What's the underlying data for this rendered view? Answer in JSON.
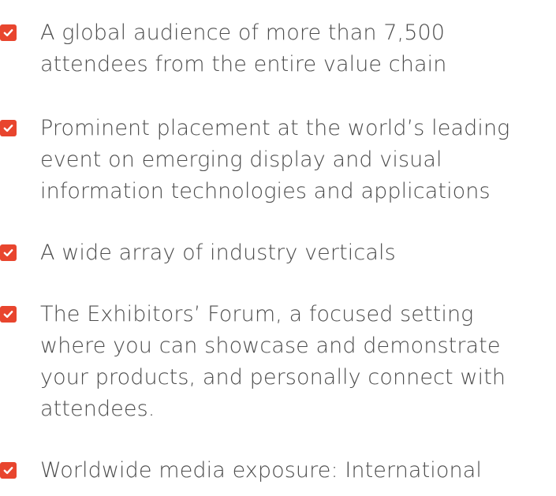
{
  "benefits": {
    "items": [
      {
        "lines": [
          "A global audience of more than 7,500",
          "attendees from the entire value chain"
        ]
      },
      {
        "lines": [
          "Prominent placement at the world’s leading",
          "event on emerging display and visual",
          "information technologies and applications"
        ]
      },
      {
        "lines": [
          "A wide array of industry verticals"
        ]
      },
      {
        "lines": [
          "The Exhibitors’ Forum, a focused setting",
          "where you can showcase and demonstrate",
          "your products, and personally connect with",
          "attendees."
        ]
      },
      {
        "lines": [
          "Worldwide media exposure: International"
        ]
      }
    ],
    "check_icon": "checkmark-icon",
    "accent_color": "#e8452e"
  }
}
